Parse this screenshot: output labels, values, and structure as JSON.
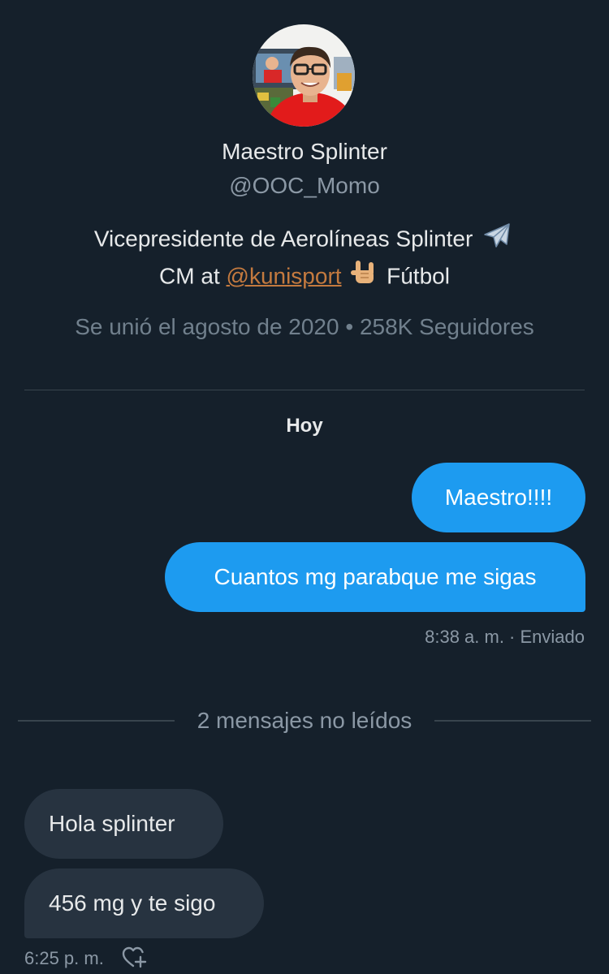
{
  "profile": {
    "name": "Maestro Splinter",
    "handle": "@OOC_Momo",
    "bio_line1": "Vicepresidente de Aerolíneas Splinter",
    "bio_line1_emoji": "airplane",
    "bio_line2_prefix": "CM at",
    "bio_line2_link": "@kunisport",
    "bio_line2_emoji": "sign-of-the-horns",
    "bio_line2_suffix": "Fútbol",
    "meta": "Se unió el agosto de 2020 • 258K Seguidores"
  },
  "conversation": {
    "day_label": "Hoy",
    "sent_messages": [
      {
        "text": "Maestro!!!!"
      },
      {
        "text": "Cuantos mg parabque me sigas"
      }
    ],
    "sent_status": "8:38 a. m. · Enviado",
    "unread_divider": "2 mensajes no leídos",
    "received_messages": [
      {
        "text": "Hola splinter"
      },
      {
        "text": "456 mg y te sigo"
      }
    ],
    "received_time": "6:25 p. m.",
    "react_icon": "heart-plus-icon"
  },
  "colors": {
    "background": "#15202b",
    "sent_bubble": "#1d9bf0",
    "received_bubble": "#273340",
    "secondary_text": "#8b98a5",
    "link": "#c47a3f",
    "divider": "#38444d"
  }
}
